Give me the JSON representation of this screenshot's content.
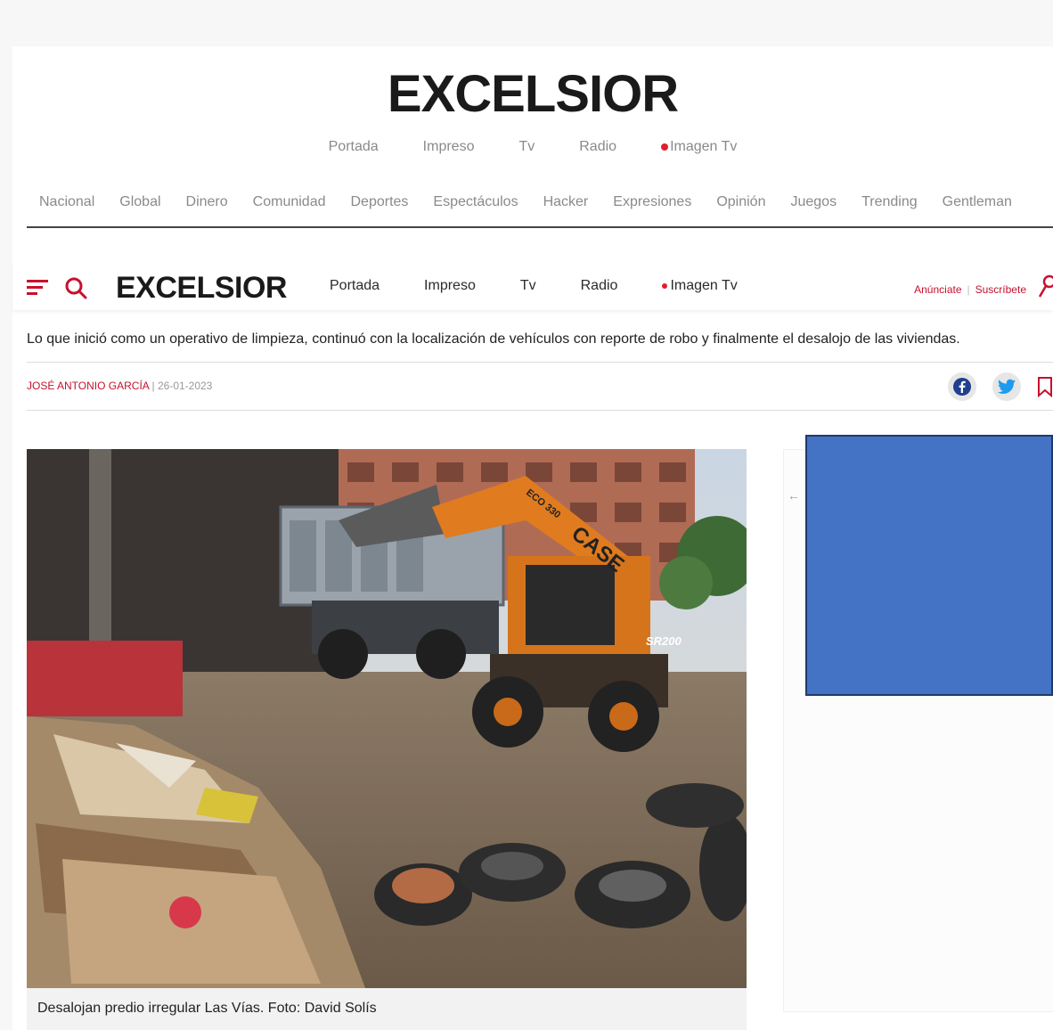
{
  "masthead": {
    "logo": "EXCELSIOR"
  },
  "top_links": [
    "Portada",
    "Impreso",
    "Tv",
    "Radio",
    "Imagen Tv"
  ],
  "sections": [
    "Nacional",
    "Global",
    "Dinero",
    "Comunidad",
    "Deportes",
    "Espectáculos",
    "Hacker",
    "Expresiones",
    "Opinión",
    "Juegos",
    "Trending",
    "Gentleman"
  ],
  "sticky": {
    "logo": "EXCELSIOR",
    "links": [
      "Portada",
      "Impreso",
      "Tv",
      "Radio",
      "Imagen Tv"
    ],
    "anunciate": "Anúnciate",
    "suscribete": "Suscríbete"
  },
  "article": {
    "summary": "Lo que inició como un operativo de limpieza, continuó con la localización de vehículos con reporte de robo y finalmente el desalojo de las viviendas.",
    "author": "JOSÉ ANTONIO GARCÍA",
    "separator": "|",
    "date": "26-01-2023",
    "caption": "Desalojan predio irregular Las Vías. Foto: David Solís"
  },
  "photo": {
    "machine_brand": "CASE",
    "machine_id": "ECO 330",
    "model": "SR200"
  },
  "sidebar": {
    "arrow": "←"
  },
  "colors": {
    "accent": "#c8102e",
    "ad_box": "#4472c4",
    "live_dot": "#e21d2c"
  }
}
